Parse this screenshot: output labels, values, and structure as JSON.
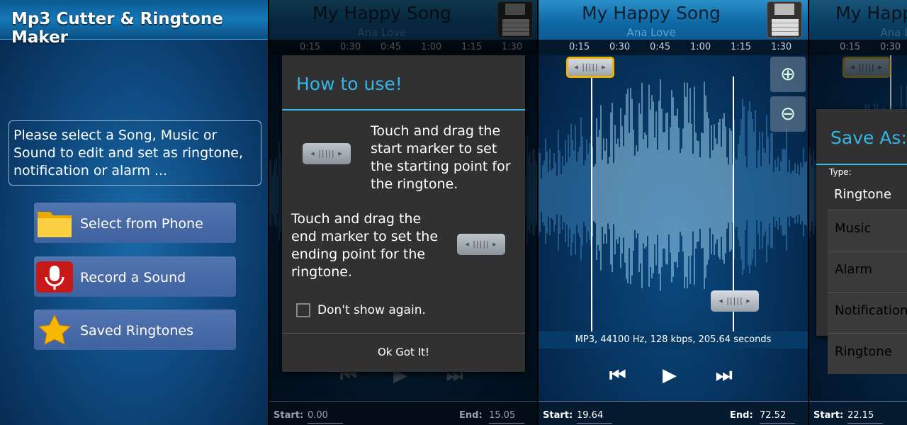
{
  "home": {
    "title": "Mp3 Cutter & Ringtone Maker",
    "prompt": "Please select a Song, Music or Sound to edit and set as ringtone, notification or alarm ...",
    "buttons": [
      {
        "label": "Select from Phone",
        "icon": "folder-icon"
      },
      {
        "label": "Record a Sound",
        "icon": "microphone-icon"
      },
      {
        "label": "Saved Ringtones",
        "icon": "star-icon"
      }
    ]
  },
  "editor": {
    "song": "My Happy Song",
    "artist": "Ana Love",
    "ticks": [
      "0:15",
      "0:30",
      "0:45",
      "1:00",
      "1:15",
      "1:30"
    ],
    "info": "MP3, 44100 Hz, 128 kbps, 205.64 seconds",
    "start_label": "Start:",
    "end_label": "End:",
    "screens": [
      {
        "start": "0.00",
        "end": "15.05"
      },
      {
        "start": "19.64",
        "end": "72.52"
      },
      {
        "start": "22.15"
      }
    ]
  },
  "howto": {
    "title": "How to use!",
    "start_text": "Touch and drag the start marker to set the starting point for the ringtone.",
    "end_text": "Touch and drag the end marker to set the ending point for the ringtone.",
    "dont_show": "Don't show again.",
    "dont_show_checked": false,
    "ok": "Ok Got It!"
  },
  "saveas": {
    "title": "Save As:",
    "type_label": "Type:",
    "selected": "Ringtone",
    "options": [
      "Music",
      "Alarm",
      "Notification",
      "Ringtone"
    ]
  },
  "colors": {
    "accent": "#33b5e5",
    "marker_selected": "#f0b400"
  }
}
